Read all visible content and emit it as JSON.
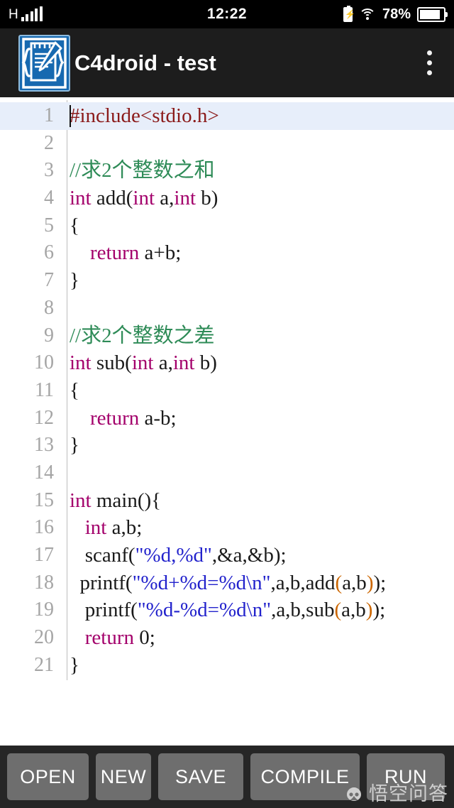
{
  "status_bar": {
    "network_type": "H",
    "signal_bars": 5,
    "clock": "12:22",
    "battery_percent": "78%",
    "battery_level": 78,
    "charging": true,
    "wifi": "wifi-icon"
  },
  "app_bar": {
    "icon": "c4droid-app-icon",
    "title": "C4droid - test",
    "overflow_menu": "overflow-menu-icon"
  },
  "editor": {
    "cursor_line": 1,
    "highlighted_line": 1,
    "colors": {
      "keyword": "#a3006b",
      "comment": "#2e8b57",
      "string": "#2222cc",
      "preprocessor": "#8b1a1a",
      "bracket_match": "#cc6600",
      "line_number": "#a5a5a5",
      "current_line_bg": "#e7eefa",
      "background": "#ffffff",
      "text": "#1a1a1a"
    },
    "lines": [
      {
        "n": "1",
        "tokens": [
          {
            "t": "#include<stdio.h>",
            "c": "pre"
          }
        ]
      },
      {
        "n": "2",
        "tokens": []
      },
      {
        "n": "3",
        "tokens": [
          {
            "t": "//求2个整数之和",
            "c": "cmt"
          }
        ]
      },
      {
        "n": "4",
        "tokens": [
          {
            "t": "int",
            "c": "kw"
          },
          {
            "t": " add(",
            "c": ""
          },
          {
            "t": "int",
            "c": "kw"
          },
          {
            "t": " a,",
            "c": ""
          },
          {
            "t": "int",
            "c": "kw"
          },
          {
            "t": " b)",
            "c": ""
          }
        ]
      },
      {
        "n": "5",
        "tokens": [
          {
            "t": "{",
            "c": ""
          }
        ]
      },
      {
        "n": "6",
        "tokens": [
          {
            "t": "    ",
            "c": ""
          },
          {
            "t": "return",
            "c": "kw"
          },
          {
            "t": " a+b;",
            "c": ""
          }
        ]
      },
      {
        "n": "7",
        "tokens": [
          {
            "t": "}",
            "c": ""
          }
        ]
      },
      {
        "n": "8",
        "tokens": []
      },
      {
        "n": "9",
        "tokens": [
          {
            "t": "//求2个整数之差",
            "c": "cmt"
          }
        ]
      },
      {
        "n": "10",
        "tokens": [
          {
            "t": "int",
            "c": "kw"
          },
          {
            "t": " sub(",
            "c": ""
          },
          {
            "t": "int",
            "c": "kw"
          },
          {
            "t": " a,",
            "c": ""
          },
          {
            "t": "int",
            "c": "kw"
          },
          {
            "t": " b)",
            "c": ""
          }
        ]
      },
      {
        "n": "11",
        "tokens": [
          {
            "t": "{",
            "c": ""
          }
        ]
      },
      {
        "n": "12",
        "tokens": [
          {
            "t": "    ",
            "c": ""
          },
          {
            "t": "return",
            "c": "kw"
          },
          {
            "t": " a-b;",
            "c": ""
          }
        ]
      },
      {
        "n": "13",
        "tokens": [
          {
            "t": "}",
            "c": ""
          }
        ]
      },
      {
        "n": "14",
        "tokens": []
      },
      {
        "n": "15",
        "tokens": [
          {
            "t": "int",
            "c": "kw"
          },
          {
            "t": " main(){",
            "c": ""
          }
        ]
      },
      {
        "n": "16",
        "tokens": [
          {
            "t": "   ",
            "c": ""
          },
          {
            "t": "int",
            "c": "kw"
          },
          {
            "t": " a,b;",
            "c": ""
          }
        ]
      },
      {
        "n": "17",
        "tokens": [
          {
            "t": "   scanf(",
            "c": ""
          },
          {
            "t": "\"%d,%d\"",
            "c": "str"
          },
          {
            "t": ",&a,&b);",
            "c": ""
          }
        ]
      },
      {
        "n": "18",
        "tokens": [
          {
            "t": "  printf(",
            "c": ""
          },
          {
            "t": "\"%d+%d=%d\\n\"",
            "c": "str"
          },
          {
            "t": ",a,b,add",
            "c": ""
          },
          {
            "t": "(",
            "c": "brk"
          },
          {
            "t": "a,b",
            "c": ""
          },
          {
            "t": ")",
            "c": "brk"
          },
          {
            "t": ");",
            "c": ""
          }
        ]
      },
      {
        "n": "19",
        "tokens": [
          {
            "t": "   printf(",
            "c": ""
          },
          {
            "t": "\"%d-%d=%d\\n\"",
            "c": "str"
          },
          {
            "t": ",a,b,sub",
            "c": ""
          },
          {
            "t": "(",
            "c": "brk"
          },
          {
            "t": "a,b",
            "c": ""
          },
          {
            "t": ")",
            "c": "brk"
          },
          {
            "t": ");",
            "c": ""
          }
        ]
      },
      {
        "n": "20",
        "tokens": [
          {
            "t": "   ",
            "c": ""
          },
          {
            "t": "return",
            "c": "kw"
          },
          {
            "t": " 0;",
            "c": ""
          }
        ]
      },
      {
        "n": "21",
        "tokens": [
          {
            "t": "}",
            "c": ""
          }
        ]
      }
    ]
  },
  "toolbar": {
    "buttons": [
      {
        "label": "OPEN",
        "name": "open-button",
        "cls": "b-open"
      },
      {
        "label": "NEW",
        "name": "new-button",
        "cls": "b-new"
      },
      {
        "label": "SAVE",
        "name": "save-button",
        "cls": "b-save"
      },
      {
        "label": "COMPILE",
        "name": "compile-button",
        "cls": "b-compile"
      },
      {
        "label": "RUN",
        "name": "run-button",
        "cls": "b-run"
      }
    ]
  },
  "watermark": {
    "text": "悟空问答",
    "logo": "wukong-wenda-logo"
  }
}
